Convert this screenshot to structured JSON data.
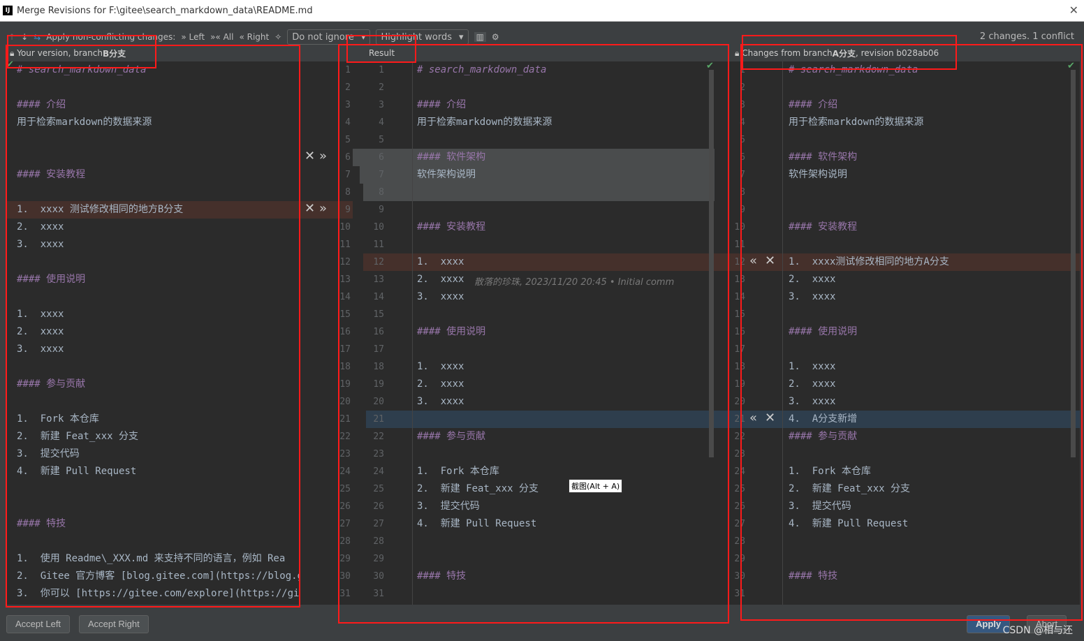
{
  "window": {
    "title": "Merge Revisions for F:\\gitee\\search_markdown_data\\README.md"
  },
  "toolbar": {
    "apply_label": "Apply non-conflicting changes:",
    "left": "Left",
    "all": "All",
    "right": "Right",
    "ignore_select": "Do not ignore",
    "highlight_select": "Highlight words",
    "status": "2 changes. 1 conflict"
  },
  "headers": {
    "left_prefix": "Your version, branch ",
    "left_branch": "B分支",
    "result": "Result",
    "right_prefix": "Changes from branch ",
    "right_branch": "A分支",
    "right_suffix": ", revision b028ab06"
  },
  "left_lines": [
    "# search_markdown_data",
    "",
    "#### 介绍",
    "用于检索markdown的数据来源",
    "",
    "",
    "#### 安装教程",
    "",
    "1.  xxxx 测试修改相同的地方B分支",
    "2.  xxxx",
    "3.  xxxx",
    "",
    "#### 使用说明",
    "",
    "1.  xxxx",
    "2.  xxxx",
    "3.  xxxx",
    "",
    "#### 参与贡献",
    "",
    "1.  Fork 本仓库",
    "2.  新建 Feat_xxx 分支",
    "3.  提交代码",
    "4.  新建 Pull Request",
    "",
    "",
    "#### 特技",
    "",
    "1.  使用 Readme\\_XXX.md 来支持不同的语言，例如 Rea",
    "2.  Gitee 官方博客 [blog.gitee.com](https://blog.g",
    "3.  你可以 [https://gitee.com/explore](https://gi"
  ],
  "result_lines": [
    "# search_markdown_data",
    "",
    "#### 介绍",
    "用于检索markdown的数据来源",
    "",
    "#### 软件架构",
    "软件架构说明",
    "",
    "",
    "#### 安装教程",
    "",
    "1.  xxxx",
    "2.  xxxx",
    "3.  xxxx",
    "",
    "#### 使用说明",
    "",
    "1.  xxxx",
    "2.  xxxx",
    "3.  xxxx",
    "",
    "#### 参与贡献",
    "",
    "1.  Fork 本仓库",
    "2.  新建 Feat_xxx 分支",
    "3.  提交代码",
    "4.  新建 Pull Request",
    "",
    "",
    "#### 特技",
    ""
  ],
  "right_lines": [
    "# search_markdown_data",
    "",
    "#### 介绍",
    "用于检索markdown的数据来源",
    "",
    "#### 软件架构",
    "软件架构说明",
    "",
    "",
    "#### 安装教程",
    "",
    "1.  xxxx测试修改相同的地方A分支",
    "2.  xxxx",
    "3.  xxxx",
    "",
    "#### 使用说明",
    "",
    "1.  xxxx",
    "2.  xxxx",
    "3.  xxxx",
    "4.  A分支新增",
    "#### 参与贡献",
    "",
    "1.  Fork 本仓库",
    "2.  新建 Feat_xxx 分支",
    "3.  提交代码",
    "4.  新建 Pull Request",
    "",
    "",
    "#### 特技",
    ""
  ],
  "blame": "散落的珍珠, 2023/11/20 20:45 • Initial comm",
  "tooltip": "截图(Alt + A)",
  "footer": {
    "accept_left": "Accept Left",
    "accept_right": "Accept Right",
    "apply": "Apply",
    "abort": "Abort"
  },
  "watermark": "CSDN @相与还",
  "colors": {
    "conflict": "#45302b",
    "modified": "#4a4c4d",
    "added": "#2e3e4d",
    "annotation": "#ff1a1a"
  }
}
